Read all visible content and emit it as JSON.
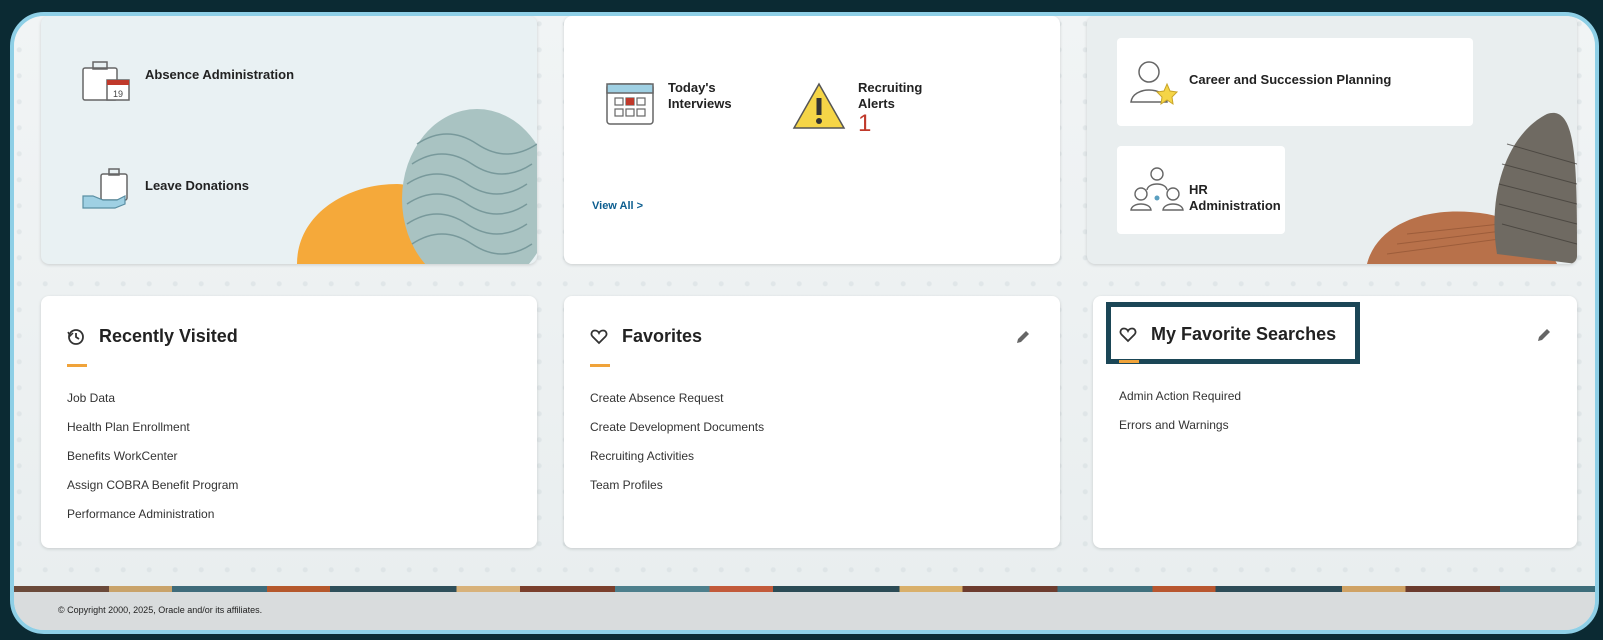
{
  "tiles_row1": {
    "absence": {
      "items": [
        {
          "label": "Absence Administration",
          "icon": "briefcase-calendar-icon"
        },
        {
          "label": "Leave Donations",
          "icon": "hand-briefcase-icon"
        }
      ]
    },
    "recruiting": {
      "interviews_label_line1": "Today's",
      "interviews_label_line2": "Interviews",
      "alerts_label_line1": "Recruiting",
      "alerts_label_line2": "Alerts",
      "alerts_count": "1",
      "view_all": "View All >"
    },
    "talent": {
      "career_label": "Career and Succession Planning",
      "hr_label_line1": "HR",
      "hr_label_line2": "Administration"
    }
  },
  "recently_visited": {
    "title": "Recently Visited",
    "items": [
      "Job Data",
      "Health Plan Enrollment",
      "Benefits WorkCenter",
      "Assign COBRA Benefit Program",
      "Performance Administration"
    ]
  },
  "favorites": {
    "title": "Favorites",
    "items": [
      "Create Absence Request",
      "Create Development Documents",
      "Recruiting Activities",
      "Team Profiles"
    ]
  },
  "favorite_searches": {
    "title": "My Favorite Searches",
    "items": [
      "Admin Action Required",
      "Errors and Warnings"
    ]
  },
  "footer": {
    "copyright": "© Copyright 2000, 2025, Oracle and/or its affiliates."
  },
  "colors": {
    "accent": "#f0a33a",
    "alert_red": "#c0392b",
    "highlight_border": "#1b4656",
    "link_blue": "#0b5d8f"
  }
}
